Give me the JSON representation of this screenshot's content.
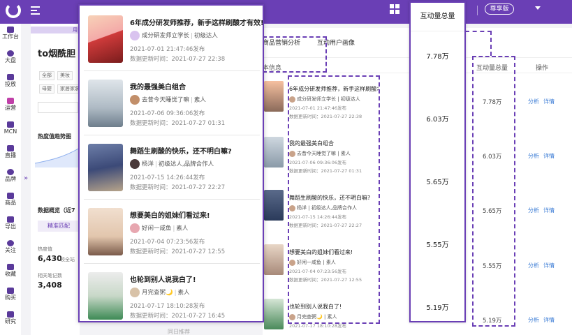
{
  "header": {
    "pro_badge": "尊享版",
    "colors": {
      "brand": "#6a3fb5"
    }
  },
  "sidebar": {
    "items": [
      {
        "label": "工作台",
        "icon": "dashboard-icon"
      },
      {
        "label": "大盘",
        "icon": "pie-chart-icon"
      },
      {
        "label": "投放",
        "icon": "wallet-icon"
      },
      {
        "label": "运营",
        "icon": "chat-icon"
      },
      {
        "label": "MCN",
        "icon": "building-icon"
      },
      {
        "label": "直播",
        "icon": "tv-icon"
      },
      {
        "label": "品牌",
        "icon": "user-icon"
      },
      {
        "label": "商品",
        "icon": "bag-icon"
      },
      {
        "label": "导出",
        "icon": "export-icon"
      },
      {
        "label": "关注",
        "icon": "eye-icon"
      },
      {
        "label": "收藏",
        "icon": "heart-icon"
      },
      {
        "label": "购买",
        "icon": "cart-icon"
      },
      {
        "label": "研究",
        "icon": "flask-icon"
      }
    ]
  },
  "left_panel": {
    "ribbon": "用",
    "title": "to烟酰胆",
    "tags": [
      "全部",
      "美妆",
      "母婴",
      "家居家装"
    ],
    "trend_label": "热度值趋势图",
    "overview_label": "数据概览（近7",
    "tab_label": "精准匹配",
    "stat1_label": "热度值",
    "stat1_value": "6,430",
    "stat1_note": "较全站",
    "stat2_label": "相关笔记数",
    "stat2_value": "3,408"
  },
  "content": {
    "tabs": [
      "商品营销分析",
      "互动用户画像"
    ],
    "columns": {
      "basic": "本信息",
      "interaction": "互动量总量",
      "action": "操作"
    },
    "actions": {
      "analyze": "分析",
      "detail": "详情"
    },
    "highlight_header": "互动量总量",
    "notes": [
      {
        "title": "6年成分研发师推荐，新手这样刷酸才有效!",
        "author": "成分研发师立学长",
        "level": "初级达人",
        "published": "2021-07-01 21:47:46发布",
        "updated": "数据更新时间：2021-07-27 22:38",
        "mid_title": "6年成分研发师推荐，新手这样刷酸才有效!",
        "mid_author": "成分研发师立学长",
        "mid_level": "初级达人",
        "mid_published": "2021-07-01 21:47:46发布",
        "mid_updated": "数据更新时间：2021-07-27 22:38",
        "interaction": "7.78万"
      },
      {
        "title": "我的最强美白组合",
        "author": "去昔今天睡觉了嘛",
        "level": "素人",
        "published": "2021-07-06 09:36:06发布",
        "updated": "数据更新时间：2021-07-27 01:31",
        "mid_title": "我的最强美白组合",
        "mid_author": "去昔今天睡觉了嘛",
        "mid_level": "素人",
        "mid_published": "2021-07-06 09:36:06发布",
        "mid_updated": "数据更新时间：2021-07-27 01:31",
        "interaction": "6.03万"
      },
      {
        "title": "舞蹈生刷酸的快乐，还不明白嘛?",
        "author": "杨洋",
        "level": "初级达人,品牌合作人",
        "published": "2021-07-15 14:26:44发布",
        "updated": "数据更新时间：2021-07-27 22:27",
        "mid_title": "舞蹈生刷酸的快乐，还不明白嘛?",
        "mid_author": "杨洋",
        "mid_level": "初级达人,品牌合作人",
        "mid_published": "2021-07-15 14:26:44发布",
        "mid_updated": "数据更新时间：2021-07-27 22:27",
        "interaction": "5.65万"
      },
      {
        "title": "想要美白的姐妹们看过来!",
        "author": "好闲一咸鱼",
        "level": "素人",
        "published": "2021-07-04 07:23:56发布",
        "updated": "数据更新时间：2021-07-27 12:55",
        "mid_title": "想要美白的姐妹们看过来!",
        "mid_author": "好闲一咸鱼",
        "mid_level": "素人",
        "mid_published": "2021-07-04 07:23:56发布",
        "mid_updated": "数据更新时间：2021-07-27 12:55",
        "interaction": "5.55万"
      },
      {
        "title": "也轮到别人说我白了!",
        "author": "月完查粥🌙",
        "level": "素人",
        "published": "2021-07-17 18:10:28发布",
        "updated": "数据更新时间：2021-07-27 16:45",
        "mid_title": "也轮到别人说我白了!",
        "mid_author": "月完查粥🌙",
        "mid_level": "素人",
        "mid_published": "2021-07-17 18:10:28发布",
        "mid_updated": "",
        "interaction": "5.19万"
      }
    ],
    "right_values": [
      "7.78万",
      "6.03万",
      "5.65万",
      "5.55万",
      "5.19万"
    ],
    "footer_ghost": "同日推荐"
  }
}
